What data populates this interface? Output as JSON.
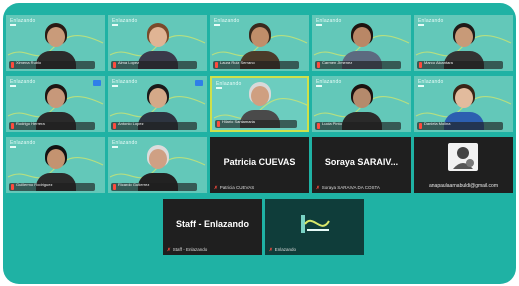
{
  "watermark": "Enlazando",
  "tiles": {
    "row1": [
      {
        "name": "Ximena Rubio",
        "skin": "#c99b7a",
        "hair": "#2a1b14",
        "shirt": "#2b2b2b"
      },
      {
        "name": "Alma Lopez",
        "skin": "#e0b494",
        "hair": "#7a4a2a",
        "shirt": "#3a3a4a"
      },
      {
        "name": "Laura Ruiz Serrano",
        "skin": "#c08e6a",
        "hair": "#3a2a1e",
        "shirt": "#4a3b2a"
      },
      {
        "name": "Carmen Jimenez",
        "skin": "#b98766",
        "hair": "#1e1410",
        "shirt": "#5c6a80"
      },
      {
        "name": "Marco Alcantara",
        "skin": "#c89a78",
        "hair": "#1f1a18",
        "shirt": "#333333"
      }
    ],
    "row2": [
      {
        "name": "Rodrigo Herrera",
        "skin": "#c7987a",
        "hair": "#1e1612",
        "shirt": "#2a2a2a"
      },
      {
        "name": "Antonio Lopez",
        "skin": "#d4a988",
        "hair": "#1a1a1a",
        "shirt": "#2d3440"
      },
      {
        "name": "Hilario Santamaria",
        "skin": "#cf9f80",
        "hair": "#d9d9d9",
        "shirt": "#4a4a4a"
      },
      {
        "name": "Lucia Pinto",
        "skin": "#b58a6c",
        "hair": "#1b1210",
        "shirt": "#2a2a2a"
      },
      {
        "name": "Daniela Molina",
        "skin": "#e2bb9d",
        "hair": "#3a2416",
        "shirt": "#2c5fb0"
      }
    ],
    "row3_video": [
      {
        "name": "Guillermo Rodriguez",
        "skin": "#c49370",
        "hair": "#121212",
        "shirt": "#2a2a2a"
      },
      {
        "name": "Ricardo Gutierrez",
        "skin": "#cfa084",
        "hair": "#dcdcdc",
        "shirt": "#222222"
      }
    ],
    "patricia": {
      "big": "Patricia CUEVAS",
      "small": "Patricia CUEVAS"
    },
    "soraya": {
      "big": "Soraya SARAIV...",
      "small": "Soraya SARAIVA DA COSTA"
    },
    "email": {
      "text": "anapaulaarnabuldi@gmail.com"
    },
    "staff": {
      "big": "Staff - Enlazando",
      "small": "Staff - Enlazando"
    },
    "enlazando": {
      "small": "Enlazando"
    }
  }
}
